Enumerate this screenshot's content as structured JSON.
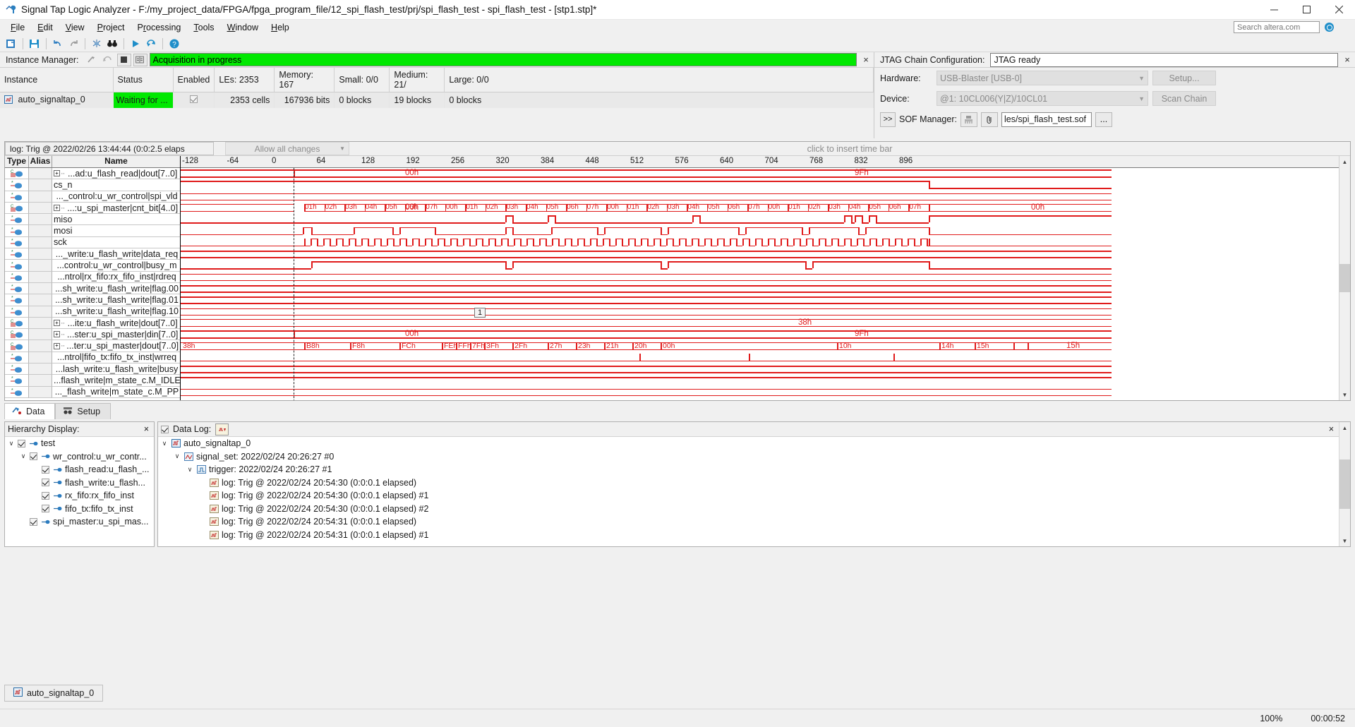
{
  "window": {
    "title": "Signal Tap Logic Analyzer - F:/my_project_data/FPGA/fpga_program_file/12_spi_flash_test/prj/spi_flash_test - spi_flash_test - [stp1.stp]*",
    "minimize": "minimize-icon",
    "maximize": "maximize-icon",
    "close": "close-icon"
  },
  "menu": {
    "items": [
      "File",
      "Edit",
      "View",
      "Project",
      "Processing",
      "Tools",
      "Window",
      "Help"
    ]
  },
  "search": {
    "placeholder": "Search altera.com",
    "value": ""
  },
  "instance_manager": {
    "title": "Instance Manager:",
    "status": "Acquisition in progress",
    "close_label": "×",
    "columns": [
      "Instance",
      "Status",
      "Enabled",
      "LEs: 2353",
      "Memory: 167",
      "Small: 0/0",
      "Medium: 21/",
      "Large: 0/0"
    ],
    "rows": [
      {
        "instance": "auto_signaltap_0",
        "status": "Waiting for ...",
        "enabled": true,
        "les": "2353 cells",
        "memory": "167936 bits",
        "small": "0 blocks",
        "medium": "19 blocks",
        "large": "0 blocks"
      }
    ]
  },
  "jtag": {
    "title": "JTAG Chain Configuration:",
    "status": "JTAG ready",
    "close_label": "×",
    "hardware_label": "Hardware:",
    "hardware_value": "USB-Blaster [USB-0]",
    "setup_button": "Setup...",
    "device_label": "Device:",
    "device_value": "@1: 10CL006(Y|Z)/10CL01",
    "scan_button": "Scan Chain",
    "sof_expand": ">>",
    "sof_label": "SOF Manager:",
    "sof_path": "les/spi_flash_test.sof",
    "sof_browse": "..."
  },
  "wave_toolbar": {
    "log_text": "log: Trig @ 2022/02/26 13:44:44 (0:0:2.5 elaps",
    "allow_changes": "Allow all changes",
    "insert_hint": "click to insert time bar"
  },
  "wave_headers": {
    "type": "Type",
    "alias": "Alias",
    "name": "Name"
  },
  "ruler": {
    "ticks": [
      "-128",
      "-64",
      "0",
      "64",
      "128",
      "192",
      "256",
      "320",
      "384",
      "448",
      "512",
      "576",
      "640",
      "704",
      "768",
      "832",
      "896"
    ]
  },
  "time_marker": "1",
  "signals": [
    {
      "icon": "bus-group-icon",
      "expandable": true,
      "name": "...ad:u_flash_read|dout[7..0]"
    },
    {
      "icon": "signal-icon",
      "expandable": false,
      "name": "cs_n"
    },
    {
      "icon": "signal-icon",
      "expandable": false,
      "name": "..._control:u_wr_control|spi_vld"
    },
    {
      "icon": "bus-group-icon",
      "expandable": true,
      "name": "...:u_spi_master|cnt_bit[4..0]"
    },
    {
      "icon": "signal-icon",
      "expandable": false,
      "name": "miso"
    },
    {
      "icon": "signal-icon",
      "expandable": false,
      "name": "mosi"
    },
    {
      "icon": "signal-icon",
      "expandable": false,
      "name": "sck"
    },
    {
      "icon": "signal-icon",
      "expandable": false,
      "name": "..._write:u_flash_write|data_req"
    },
    {
      "icon": "signal-icon",
      "expandable": false,
      "name": "...control:u_wr_control|busy_m"
    },
    {
      "icon": "signal-icon",
      "expandable": false,
      "name": "...ntrol|rx_fifo:rx_fifo_inst|rdreq"
    },
    {
      "icon": "signal-icon",
      "expandable": false,
      "name": "...sh_write:u_flash_write|flag.00"
    },
    {
      "icon": "signal-icon",
      "expandable": false,
      "name": "...sh_write:u_flash_write|flag.01"
    },
    {
      "icon": "signal-icon",
      "expandable": false,
      "name": "...sh_write:u_flash_write|flag.10"
    },
    {
      "icon": "bus-group-icon",
      "expandable": true,
      "name": "...ite:u_flash_write|dout[7..0]"
    },
    {
      "icon": "bus-group-icon",
      "expandable": true,
      "name": "...ster:u_spi_master|din[7..0]"
    },
    {
      "icon": "bus-group-icon",
      "expandable": true,
      "name": "...ter:u_spi_master|dout[7..0]"
    },
    {
      "icon": "signal-icon",
      "expandable": false,
      "name": "...ntrol|fifo_tx:fifo_tx_inst|wrreq"
    },
    {
      "icon": "signal-icon",
      "expandable": false,
      "name": "...lash_write:u_flash_write|busy"
    },
    {
      "icon": "signal-icon",
      "expandable": false,
      "name": "...flash_write|m_state_c.M_IDLE"
    },
    {
      "icon": "signal-icon",
      "expandable": false,
      "name": "..._flash_write|m_state_c.M_PP"
    }
  ],
  "wave_values": {
    "row0": [
      {
        "t": 330,
        "v": "00h"
      },
      {
        "t": 968,
        "v": "9Fh"
      }
    ],
    "row3_left": "00h",
    "row3_right": "00h",
    "row3_seq": [
      "01h",
      "02h",
      "03h",
      "04h",
      "05h",
      "06h",
      "07h",
      "00h",
      "01h",
      "02h",
      "03h",
      "04h",
      "05h",
      "06h",
      "07h",
      "00h",
      "01h",
      "02h",
      "03h",
      "04h",
      "05h",
      "06h",
      "07h",
      "00h",
      "01h",
      "02h",
      "03h",
      "04h",
      "05h",
      "06h",
      "07h"
    ],
    "row13": "38h",
    "row14_left": "00h",
    "row14_right": "9Fh",
    "row15": [
      "38h",
      "B8h",
      "F8h",
      "FCh",
      "FEh",
      "FFh",
      "7Fh",
      "3Fh",
      "2Fh",
      "27h",
      "23h",
      "21h",
      "20h",
      "00h",
      "10h",
      "14h",
      "15h"
    ]
  },
  "tabs": [
    {
      "label": "Data",
      "icon": "data-icon",
      "active": true
    },
    {
      "label": "Setup",
      "icon": "setup-icon",
      "active": false
    }
  ],
  "hierarchy": {
    "title": "Hierarchy Display:",
    "close_label": "×",
    "nodes": [
      {
        "indent": 0,
        "twist": "∨",
        "checked": true,
        "label": "test",
        "icon": "module-icon"
      },
      {
        "indent": 1,
        "twist": "∨",
        "checked": true,
        "label": "wr_control:u_wr_contr...",
        "icon": "module-icon"
      },
      {
        "indent": 2,
        "twist": "",
        "checked": true,
        "label": "flash_read:u_flash_...",
        "icon": "module-icon"
      },
      {
        "indent": 2,
        "twist": "",
        "checked": true,
        "label": "flash_write:u_flash...",
        "icon": "module-icon"
      },
      {
        "indent": 2,
        "twist": "",
        "checked": true,
        "label": "rx_fifo:rx_fifo_inst",
        "icon": "module-icon"
      },
      {
        "indent": 2,
        "twist": "",
        "checked": true,
        "label": "fifo_tx:fifo_tx_inst",
        "icon": "module-icon"
      },
      {
        "indent": 1,
        "twist": "",
        "checked": true,
        "label": "spi_master:u_spi_mas...",
        "icon": "module-icon"
      }
    ]
  },
  "data_log": {
    "title": "Data Log:",
    "checked": true,
    "icon": "log-icon",
    "close_label": "×",
    "nodes": [
      {
        "indent": 0,
        "twist": "∨",
        "icon": "instance-icon",
        "label": "auto_signaltap_0"
      },
      {
        "indent": 1,
        "twist": "∨",
        "icon": "signalset-icon",
        "label": "signal_set: 2022/02/24 20:26:27  #0"
      },
      {
        "indent": 2,
        "twist": "∨",
        "icon": "trigger-icon",
        "label": "trigger: 2022/02/24 20:26:27  #1"
      },
      {
        "indent": 3,
        "twist": "",
        "icon": "log-entry-icon",
        "label": "log: Trig @ 2022/02/24 20:54:30 (0:0:0.1 elapsed)"
      },
      {
        "indent": 3,
        "twist": "",
        "icon": "log-entry-icon",
        "label": "log: Trig @ 2022/02/24 20:54:30 (0:0:0.1 elapsed) #1"
      },
      {
        "indent": 3,
        "twist": "",
        "icon": "log-entry-icon",
        "label": "log: Trig @ 2022/02/24 20:54:30 (0:0:0.1 elapsed) #2"
      },
      {
        "indent": 3,
        "twist": "",
        "icon": "log-entry-icon",
        "label": "log: Trig @ 2022/02/24 20:54:31 (0:0:0.1 elapsed)"
      },
      {
        "indent": 3,
        "twist": "",
        "icon": "log-entry-icon",
        "label": "log: Trig @ 2022/02/24 20:54:31 (0:0:0.1 elapsed) #1"
      }
    ]
  },
  "bottom_tab": {
    "label": "auto_signaltap_0",
    "icon": "instance-icon"
  },
  "statusbar": {
    "zoom": "100%",
    "elapsed": "00:00:52"
  },
  "colors": {
    "wave_red": "#e01b1b",
    "status_green": "#00e800",
    "accent_blue": "#1f8ec9"
  }
}
